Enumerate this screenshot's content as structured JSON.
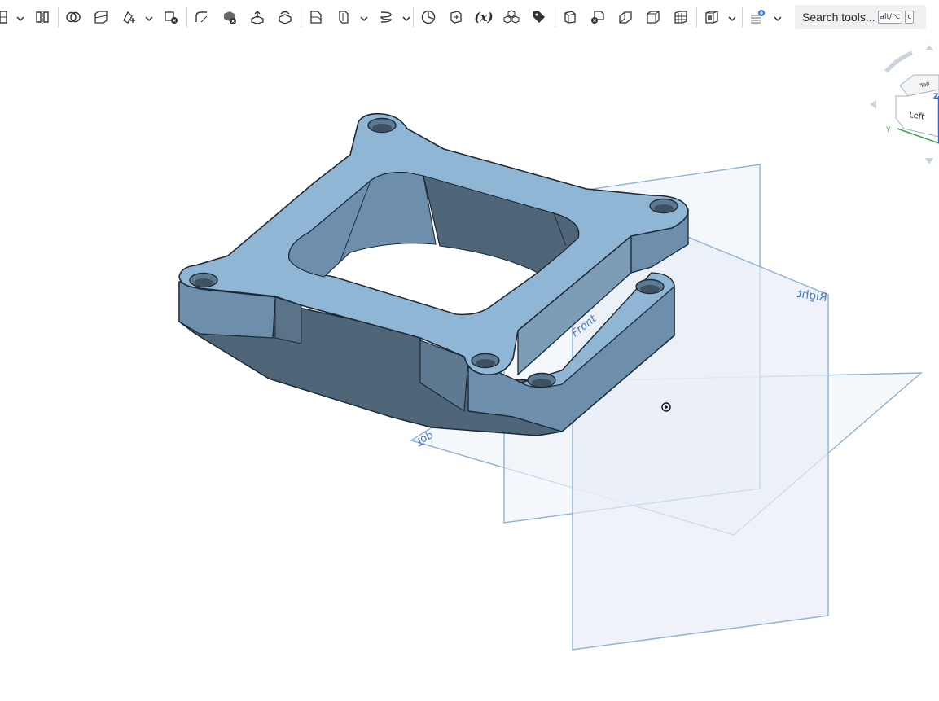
{
  "toolbar": {
    "tools": [
      {
        "name": "tool-partial-icon",
        "icon": "partial-icon"
      },
      {
        "name": "tool-mirror-icon",
        "icon": "mirror-icon"
      },
      {
        "name": "tool-boolean-icon",
        "icon": "boolean-icon"
      },
      {
        "name": "tool-split-icon",
        "icon": "split-icon"
      },
      {
        "name": "tool-transform-icon",
        "icon": "transform-icon"
      },
      {
        "name": "tool-delete-part-icon",
        "icon": "delete-part-icon"
      },
      {
        "name": "tool-modify-fillet-icon",
        "icon": "modify-fillet-icon"
      },
      {
        "name": "tool-delete-face-icon",
        "icon": "delete-face-icon"
      },
      {
        "name": "tool-move-face-icon",
        "icon": "move-face-icon"
      },
      {
        "name": "tool-replace-face-icon",
        "icon": "replace-face-icon"
      },
      {
        "name": "tool-plane-icon",
        "icon": "plane-icon"
      },
      {
        "name": "tool-mate-connector-icon",
        "icon": "mate-connector-icon"
      },
      {
        "name": "tool-helix-icon",
        "icon": "helix-icon"
      },
      {
        "name": "tool-variable-icon",
        "icon": "variable-icon"
      },
      {
        "name": "tool-derived-icon",
        "icon": "derived-icon"
      },
      {
        "name": "tool-variable-fx-icon",
        "icon": "variable-fx-icon"
      },
      {
        "name": "tool-configure-icon",
        "icon": "configure-icon"
      },
      {
        "name": "tool-tag-icon",
        "icon": "tag-icon"
      },
      {
        "name": "tool-sheet-metal-icon",
        "icon": "sheet-metal-icon"
      },
      {
        "name": "tool-sheet-metal-end-icon",
        "icon": "sheet-metal-end-icon"
      },
      {
        "name": "tool-flange-icon",
        "icon": "flange-icon"
      },
      {
        "name": "tool-tab-icon",
        "icon": "tab-icon"
      },
      {
        "name": "tool-sheet-table-icon",
        "icon": "sheet-table-icon"
      },
      {
        "name": "tool-finish-icon",
        "icon": "finish-icon"
      },
      {
        "name": "tool-render-icon",
        "icon": "render-icon"
      }
    ],
    "fx_label": "(x)",
    "search": {
      "placeholder": "Search tools...",
      "shortcut_mod": "alt/⌥",
      "shortcut_key": "c"
    }
  },
  "viewport": {
    "planes": {
      "top": "Top",
      "front": "Front",
      "right": "Right"
    },
    "view_cube": {
      "top_face": "Top",
      "left_face": "Left",
      "axis_y": "Y",
      "axis_z": "Z"
    },
    "colors": {
      "part_top": "#8fb6d4",
      "part_side": "#6d8fab",
      "part_dark": "#4f6678",
      "plane_stroke": "#8fb1d4",
      "plane_fill": "#eef3f9",
      "plane_label": "#4a79b8"
    }
  }
}
